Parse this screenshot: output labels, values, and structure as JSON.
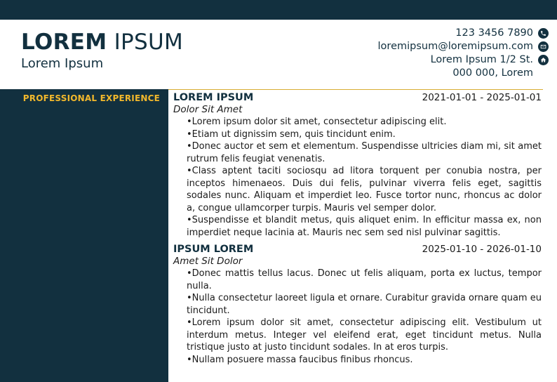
{
  "header": {
    "name_bold": "LOREM",
    "name_light": "IPSUM",
    "subtitle": "Lorem Ipsum",
    "contact": {
      "phone": "123 3456 7890",
      "email": "loremipsum@loremipsum.com",
      "address_line1": "Lorem Ipsum 1/2 St.",
      "address_line2": "000 000, Lorem",
      "phone_icon": "phone-icon",
      "email_icon": "envelope-icon",
      "address_icon": "home-icon"
    }
  },
  "sidebar": {
    "section_title": "PROFESSIONAL EXPERIENCE"
  },
  "colors": {
    "navy": "#12303f",
    "accent": "#f2b82c"
  },
  "experience": [
    {
      "title": "LOREM IPSUM",
      "dates": "2021-01-01 - 2025-01-01",
      "company": "Dolor Sit Amet",
      "bullets": [
        "Lorem ipsum dolor sit amet, consectetur adipiscing elit.",
        "Etiam ut dignissim sem, quis tincidunt enim.",
        "Donec auctor et sem et elementum. Suspendisse ultricies diam mi, sit amet rutrum felis feugiat venenatis.",
        "Class aptent taciti sociosqu ad litora torquent per conubia nostra, per inceptos himenaeos. Duis dui felis, pulvinar viverra felis eget, sagittis sodales nunc. Aliquam et imperdiet leo. Fusce tortor nunc, rhoncus ac dolor a, congue ullamcorper turpis. Mauris vel semper dolor.",
        "Suspendisse et blandit metus, quis aliquet enim. In efficitur massa ex, non imperdiet neque lacinia at. Mauris nec sem sed nisl pulvinar sagittis."
      ]
    },
    {
      "title": "IPSUM LOREM",
      "dates": "2025-01-10 - 2026-01-10",
      "company": "Amet Sit Dolor",
      "bullets": [
        "Donec mattis tellus lacus. Donec ut felis aliquam, porta ex luctus, tempor nulla.",
        "Nulla consectetur laoreet ligula et ornare. Curabitur gravida ornare quam eu tincidunt.",
        "Lorem ipsum dolor sit amet, consectetur adipiscing elit. Vestibulum ut interdum metus. Integer vel eleifend erat, eget tincidunt metus. Nulla tristique justo at justo tincidunt sodales. In at eros turpis.",
        "Nullam posuere massa faucibus finibus rhoncus."
      ]
    }
  ]
}
